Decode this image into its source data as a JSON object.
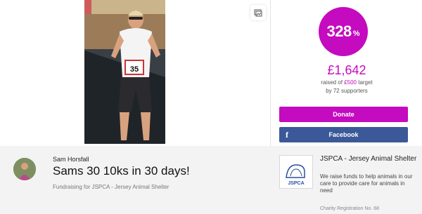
{
  "progress": {
    "percent_value": "328",
    "percent_sign": "%",
    "fraction": 3.28
  },
  "stats": {
    "amount": "£1,642",
    "raised_prefix": "raised of ",
    "target": "£500",
    "raised_suffix": " target",
    "supporters_prefix": "by ",
    "supporters_count": "72",
    "supporters_suffix": " supporters"
  },
  "buttons": {
    "donate": "Donate",
    "facebook": "Facebook",
    "facebook_glyph": "f"
  },
  "page": {
    "owner": "Sam Horsfall",
    "title": "Sams 30 10ks in 30 days!",
    "fundraising_for": "Fundraising for JSPCA - Jersey Animal Shelter"
  },
  "charity": {
    "name": "JSPCA - Jersey Animal Shelter",
    "description": "We raise funds to help animals in our care to provide care for animals in need",
    "registration": "Charity Registration No. 68",
    "logo_text": "JSPCA"
  },
  "photo": {
    "bib_number": "35"
  },
  "colors": {
    "brand": "#c40bbf",
    "facebook": "#3b5998"
  },
  "icons": {
    "gallery": "gallery-icon",
    "facebook": "facebook-icon"
  }
}
